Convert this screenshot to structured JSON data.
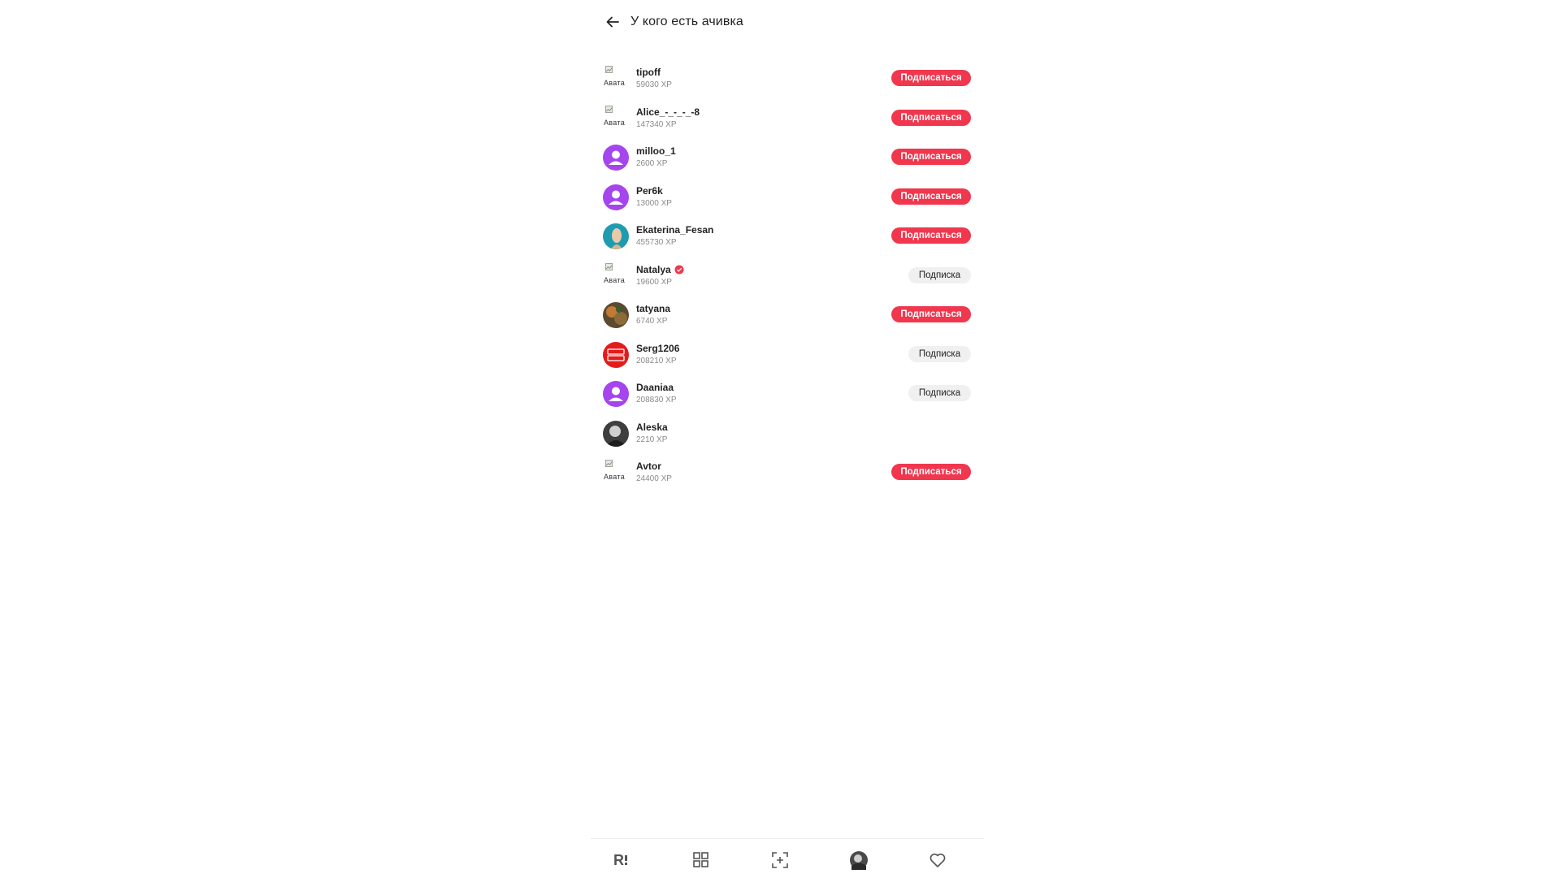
{
  "header": {
    "title": "У кого есть ачивка"
  },
  "users": [
    {
      "name": "tipoff",
      "xp": "59030 XP",
      "avatar": "broken",
      "avatar_alt": "Авата",
      "button": "subscribe",
      "button_label": "Подписаться"
    },
    {
      "name": "Alice_-_-_-_-8",
      "xp": "147340 XP",
      "avatar": "broken",
      "avatar_alt": "Авата",
      "button": "subscribe",
      "button_label": "Подписаться"
    },
    {
      "name": "milloo_1",
      "xp": "2600 XP",
      "avatar": "default",
      "button": "subscribe",
      "button_label": "Подписаться"
    },
    {
      "name": "Per6k",
      "xp": "13000 XP",
      "avatar": "default",
      "button": "subscribe",
      "button_label": "Подписаться"
    },
    {
      "name": "Ekaterina_Fesan",
      "xp": "455730 XP",
      "avatar": "photo-teal",
      "button": "subscribe",
      "button_label": "Подписаться"
    },
    {
      "name": "Natalya",
      "xp": "19600 XP",
      "avatar": "broken",
      "avatar_alt": "Авата",
      "verified": true,
      "button": "subscribed",
      "button_label": "Подписка"
    },
    {
      "name": "tatyana",
      "xp": "6740 XP",
      "avatar": "photo-warm",
      "button": "subscribe",
      "button_label": "Подписаться"
    },
    {
      "name": "Serg1206",
      "xp": "208210 XP",
      "avatar": "photo-red-logo",
      "button": "subscribed",
      "button_label": "Подписка"
    },
    {
      "name": "Daaniaa",
      "xp": "208830 XP",
      "avatar": "default",
      "button": "subscribed",
      "button_label": "Подписка"
    },
    {
      "name": "Aleska",
      "xp": "2210 XP",
      "avatar": "photo-gray",
      "button": "none",
      "button_label": ""
    },
    {
      "name": "Avtor",
      "xp": "24400 XP",
      "avatar": "broken",
      "avatar_alt": "Авата",
      "button": "subscribe",
      "button_label": "Подписаться"
    }
  ],
  "tabbar": {
    "items": [
      {
        "icon": "home-logo-icon"
      },
      {
        "icon": "catalog-grid-icon"
      },
      {
        "icon": "add-scan-icon"
      },
      {
        "icon": "profile-avatar-icon"
      },
      {
        "icon": "heart-icon"
      }
    ]
  },
  "colors": {
    "accent": "#f0374e",
    "default_avatar": "#a445ee",
    "muted_text": "#8a8a8a"
  }
}
